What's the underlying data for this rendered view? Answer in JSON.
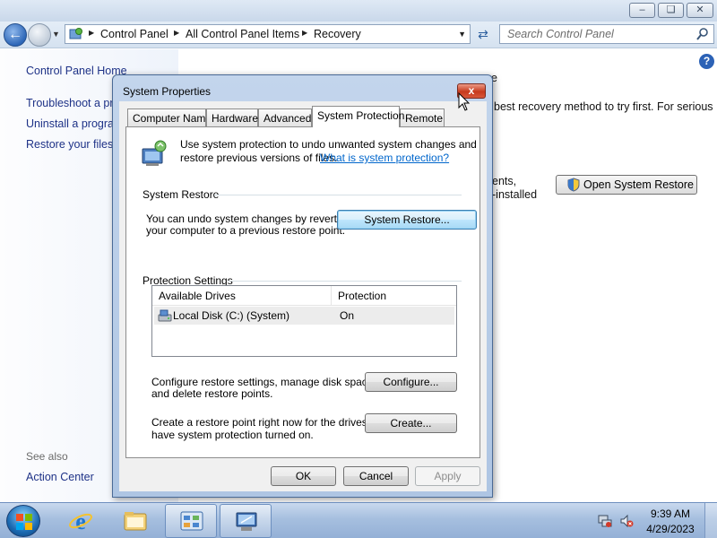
{
  "address_bar": {
    "crumbs": [
      "Control Panel",
      "All Control Panel Items",
      "Recovery"
    ]
  },
  "search": {
    "placeholder": "Search Control Panel"
  },
  "left_pane": {
    "home": "Control Panel Home",
    "links": [
      "Troubleshoot a pr",
      "Uninstall a progra",
      "Restore your files"
    ],
    "see_also": "See also",
    "action_center": "Action Center"
  },
  "recovery_page": {
    "heading_fragment": "e",
    "line1_fragment": "best recovery method to try first. For serious",
    "line2_fragment": "ents,",
    "line3_fragment": "-installed",
    "open_system_restore": "Open System Restore"
  },
  "dialog": {
    "title": "System Properties",
    "close_label": "x",
    "tabs": [
      "Computer Name",
      "Hardware",
      "Advanced",
      "System Protection",
      "Remote"
    ],
    "active_tab": "System Protection",
    "intro_line1": "Use system protection to undo unwanted system changes and",
    "intro_line2": "restore previous versions of files.",
    "intro_link": "What is system protection?",
    "system_restore": {
      "header": "System Restore",
      "desc_line1": "You can undo system changes by reverting",
      "desc_line2": "your computer to a previous restore point.",
      "button": "System Restore..."
    },
    "protection_settings": {
      "header": "Protection Settings",
      "columns": [
        "Available Drives",
        "Protection"
      ],
      "rows": [
        {
          "drive": "Local Disk (C:) (System)",
          "protection": "On"
        }
      ],
      "configure_line1": "Configure restore settings, manage disk space,",
      "configure_line2": "and delete restore points.",
      "configure_button": "Configure...",
      "create_line1": "Create a restore point right now for the drives that",
      "create_line2": "have system protection turned on.",
      "create_button": "Create..."
    },
    "buttons": {
      "ok": "OK",
      "cancel": "Cancel",
      "apply": "Apply"
    }
  },
  "taskbar": {
    "time": "9:39 AM",
    "date": "4/29/2023",
    "pinned": [
      "internet-explorer",
      "windows-explorer",
      "control-panel",
      "system-properties"
    ]
  },
  "colors": {
    "link": "#1e3287",
    "dialog_frame": "#aec5e3",
    "close_red": "#c7391d",
    "taskbar": "#a6bfdf"
  }
}
